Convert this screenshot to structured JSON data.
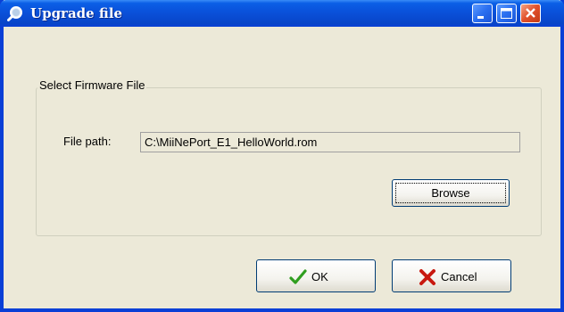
{
  "window": {
    "title": "Upgrade file"
  },
  "group": {
    "title": "Select Firmware File",
    "file_path_label": "File path:",
    "file_path_value": "C:\\MiiNePort_E1_HelloWorld.rom",
    "browse_label": "Browse"
  },
  "buttons": {
    "ok_label": "OK",
    "cancel_label": "Cancel"
  },
  "icons": {
    "title": "magnifier-icon",
    "ok": "green-checkmark-icon",
    "cancel": "red-x-icon"
  },
  "colors": {
    "titlebar": "#0a4fd8",
    "window_bg": "#ece9d8",
    "close_button": "#e0502a"
  }
}
